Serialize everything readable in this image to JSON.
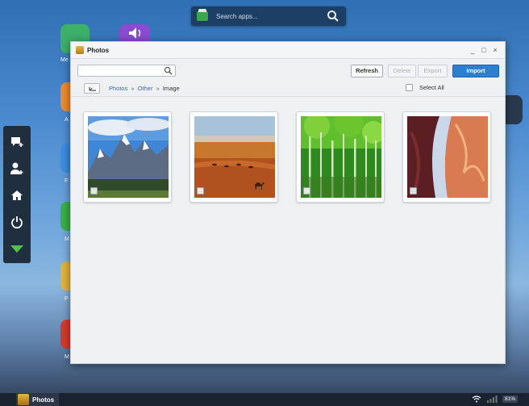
{
  "topbar": {
    "search_placeholder": "Search apps...",
    "store_icon": "app-store-icon",
    "search_icon": "search-icon"
  },
  "desktop": {
    "labels": [
      "Me",
      "A",
      "F",
      "M",
      "P",
      "M"
    ]
  },
  "dock": {
    "items": [
      {
        "icon": "chat-add-icon"
      },
      {
        "icon": "add-user-icon"
      },
      {
        "icon": "home-icon"
      },
      {
        "icon": "power-icon"
      },
      {
        "icon": "down-arrow-icon"
      }
    ]
  },
  "window": {
    "title": "Photos",
    "controls": {
      "minimize": "_",
      "maximize": "□",
      "close": "×"
    },
    "toolbar": {
      "search_value": "",
      "refresh_label": "Refresh",
      "delete_label": "Delete",
      "export_label": "Export",
      "import_label": "Import"
    },
    "breadcrumb": {
      "root": "Photos",
      "sep1": "»",
      "mid": "Other",
      "sep2": "»",
      "current": "Image"
    },
    "select_all_label": "Select All",
    "photos": [
      {
        "name": "mountains",
        "checked": false
      },
      {
        "name": "desert-camels",
        "checked": false
      },
      {
        "name": "forest",
        "checked": false
      },
      {
        "name": "canyon",
        "checked": false
      }
    ]
  },
  "taskbar": {
    "app_label": "Photos",
    "battery": "81%"
  },
  "colors": {
    "accent": "#2f7fd0",
    "link": "#2f6ebf",
    "dock": "#1f2f40"
  }
}
